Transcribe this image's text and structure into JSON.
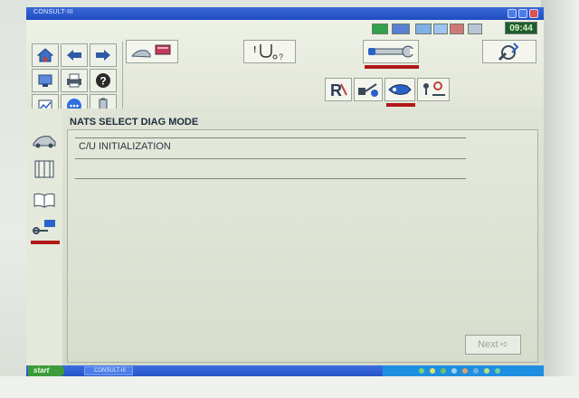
{
  "window": {
    "title": "CONSULT-III"
  },
  "status": {
    "clock": "09:44"
  },
  "toolbar": {
    "nav": [
      "home-icon",
      "back-arrow-icon",
      "forward-arrow-icon",
      "screen-capture-icon",
      "print-icon",
      "help-icon",
      "recorded-data-icon",
      "settings-icon",
      "battery-icon"
    ],
    "function_buttons": [
      "vehicle-ecu-icon",
      "diagnosis-stethoscope-icon",
      "wrench-icon",
      "settings-tool-icon"
    ],
    "sub_buttons": [
      "reprogram-icon",
      "immobilizer-icon",
      "diag-connector-icon",
      "key-tools-icon"
    ]
  },
  "main": {
    "mode_title": "NATS SELECT DIAG MODE",
    "items": [
      "C/U INITIALIZATION"
    ],
    "next_label": "Next"
  },
  "taskbar": {
    "start_label": "start",
    "task_label": "CONSULT-III"
  },
  "colors": {
    "accent_red": "#b01818",
    "titlebar_blue": "#2754c4",
    "clock_green": "#1e5e2e"
  }
}
